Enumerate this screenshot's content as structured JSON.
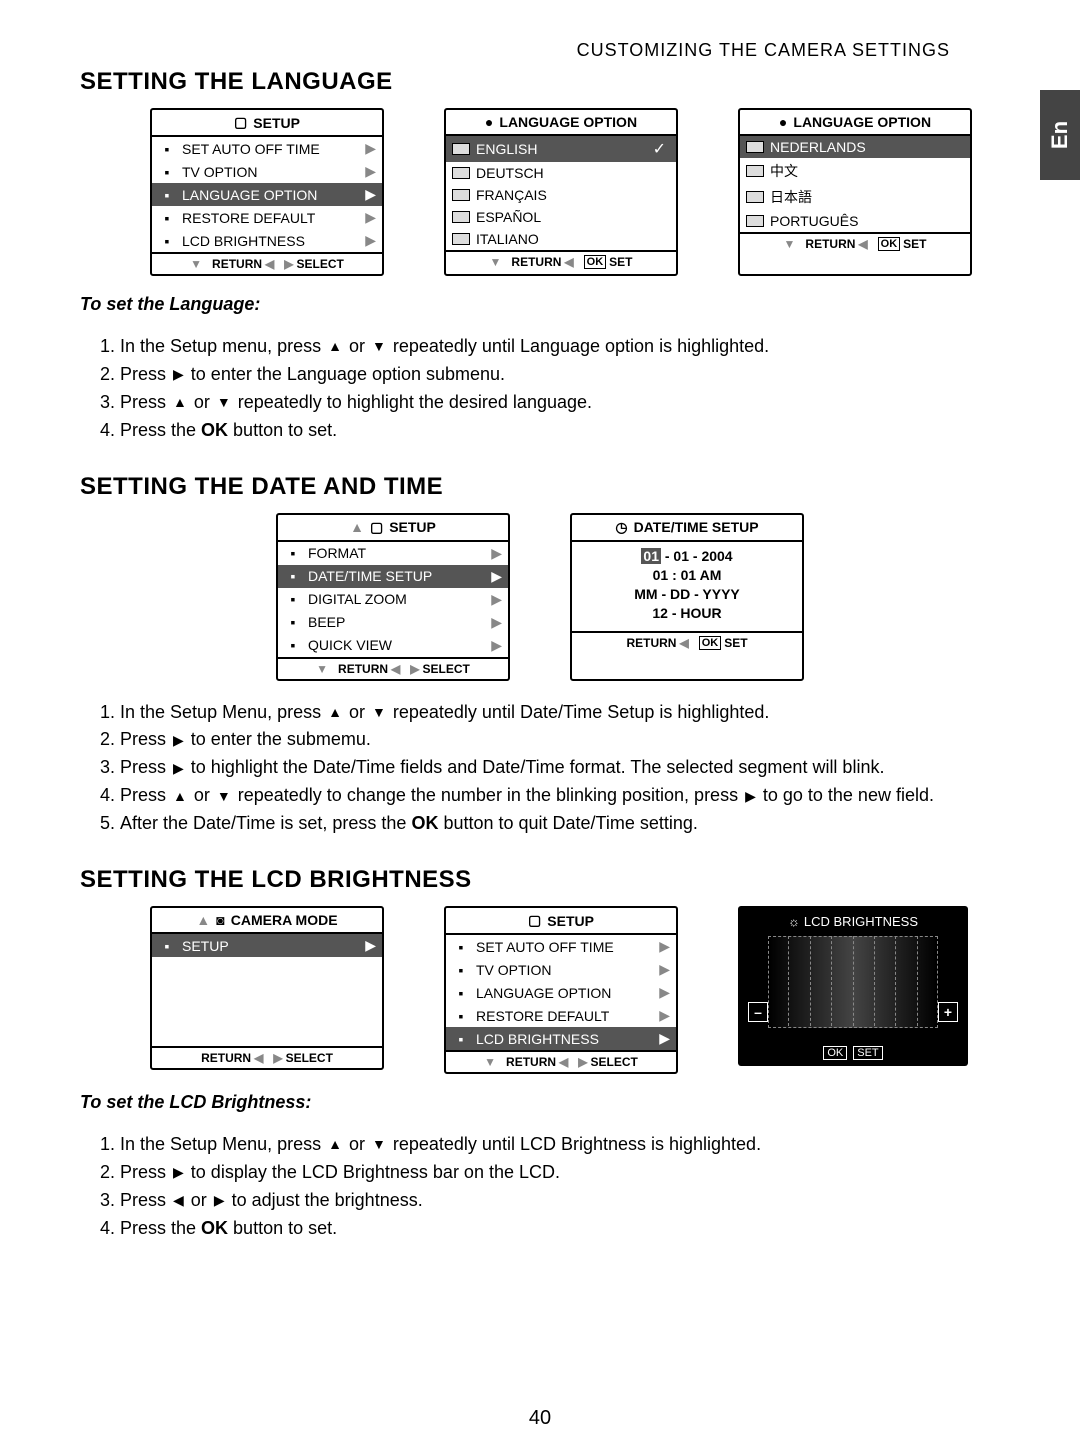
{
  "breadcrumb": "CUSTOMIZING THE CAMERA SETTINGS",
  "side_tab": "En",
  "page_number": "40",
  "common": {
    "return": "RETURN",
    "select": "SELECT",
    "set": "SET",
    "ok": "OK",
    "setup": "SETUP"
  },
  "sect_lang": {
    "heading": "SETTING THE LANGUAGE",
    "menu1": {
      "title": "SETUP",
      "items": [
        {
          "label": "SET AUTO OFF TIME"
        },
        {
          "label": "TV OPTION"
        },
        {
          "label": "LANGUAGE OPTION",
          "hl": true
        },
        {
          "label": "RESTORE DEFAULT"
        },
        {
          "label": "LCD BRIGHTNESS"
        }
      ]
    },
    "menu2": {
      "title": "LANGUAGE  OPTION",
      "items": [
        {
          "label": "ENGLISH",
          "hl": true,
          "check": true
        },
        {
          "label": "DEUTSCH"
        },
        {
          "label": "FRANÇAIS"
        },
        {
          "label": "ESPAÑOL"
        },
        {
          "label": "ITALIANO"
        }
      ]
    },
    "menu3": {
      "title": "LANGUAGE  OPTION",
      "items": [
        {
          "label": "NEDERLANDS",
          "hl": true
        },
        {
          "label": "中文"
        },
        {
          "label": "日本語"
        },
        {
          "label": "PORTUGUÊS"
        }
      ]
    },
    "howto_title": "To set the Language:",
    "steps": [
      "In the Setup menu, press ▲ or ▼ repeatedly until Language option is highlighted.",
      "Press ▶ to enter the Language option submenu.",
      "Press ▲ or ▼ repeatedly to highlight the desired language.",
      "Press the OK button to set."
    ]
  },
  "sect_dt": {
    "heading": "SETTING THE DATE AND TIME",
    "menu1": {
      "title": "SETUP",
      "items": [
        {
          "label": "FORMAT"
        },
        {
          "label": "DATE/TIME SETUP",
          "hl": true
        },
        {
          "label": "DIGITAL ZOOM"
        },
        {
          "label": "BEEP"
        },
        {
          "label": "QUICK VIEW"
        }
      ]
    },
    "menu2": {
      "title": "DATE/TIME SETUP",
      "date_seg": "01",
      "date_rest": " - 01 - 2004",
      "time": "01 : 01 AM",
      "fmt1": "MM - DD - YYYY",
      "fmt2": "12 - HOUR"
    },
    "steps": [
      "In the Setup Menu, press ▲ or ▼ repeatedly until Date/Time Setup is highlighted.",
      "Press ▶ to enter the submemu.",
      "Press ▶ to highlight the Date/Time fields and Date/Time format. The selected segment will blink.",
      "Press ▲ or ▼ repeatedly to change the number in the blinking position, press ▶ to go to the new field.",
      "After the Date/Time is set, press the OK button to quit Date/Time setting."
    ]
  },
  "sect_lcd": {
    "heading": "SETTING THE LCD BRIGHTNESS",
    "menu1": {
      "title": "CAMERA MODE",
      "items": [
        {
          "label": "SETUP",
          "hl": true
        }
      ]
    },
    "menu2": {
      "title": "SETUP",
      "items": [
        {
          "label": "SET AUTO OFF TIME"
        },
        {
          "label": "TV OPTION"
        },
        {
          "label": "LANGUAGE OPTION"
        },
        {
          "label": "RESTORE DEFAULT"
        },
        {
          "label": "LCD BRIGHTNESS",
          "hl": true
        }
      ]
    },
    "lcdbox": {
      "title": "LCD BRIGHTNESS",
      "minus": "–",
      "plus": "+",
      "ok": "OK",
      "set": "SET"
    },
    "howto_title": "To set the LCD Brightness:",
    "steps": [
      "In the Setup Menu, press ▲ or ▼ repeatedly until LCD Brightness is highlighted.",
      "Press ▶ to display the LCD Brightness bar on the LCD.",
      "Press ◀ or ▶ to adjust the brightness.",
      "Press the OK button to set."
    ]
  }
}
